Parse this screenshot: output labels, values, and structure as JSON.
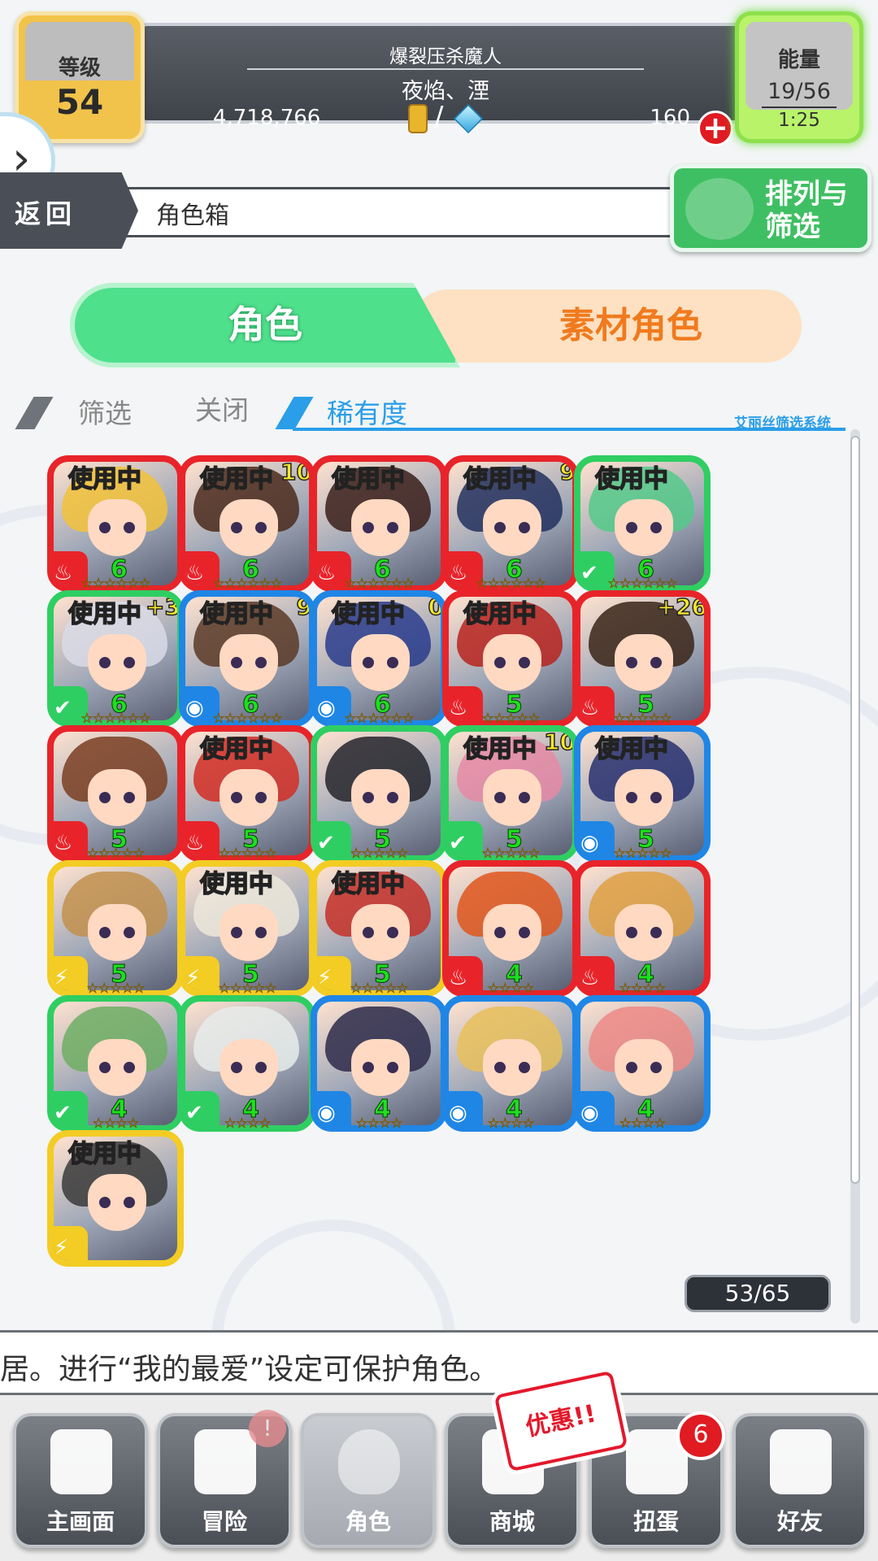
{
  "header": {
    "level_label": "等级",
    "level_value": "54",
    "title_line1": "爆裂压杀魔人",
    "title_line2": "夜焰、湮",
    "gold": "4,718,766",
    "currency_sep": "/",
    "gems": "160",
    "energy_label": "能量",
    "energy_value": "19/56",
    "energy_timer": "1:25"
  },
  "subbar": {
    "back_label": "返回",
    "title": "角色箱",
    "sort_label": "排列与筛选"
  },
  "tabs": {
    "characters": "角色",
    "materials": "素材角色"
  },
  "filter": {
    "filter_label": "筛选",
    "state_label": "关闭",
    "sort_key": "稀有度",
    "system_label": "艾丽丝筛选系统"
  },
  "cards": [
    {
      "elem": "fire",
      "rank": "6",
      "stars": "☆☆☆☆☆☆",
      "in_use": "使用中",
      "luck": "",
      "hair": "#f2c23a"
    },
    {
      "elem": "fire",
      "rank": "6",
      "stars": "☆☆☆☆☆☆",
      "in_use": "使用中",
      "luck": "10",
      "hair": "#4b2a1c"
    },
    {
      "elem": "fire",
      "rank": "6",
      "stars": "☆☆☆☆☆☆",
      "in_use": "使用中",
      "luck": "",
      "hair": "#3b1e1a"
    },
    {
      "elem": "fire",
      "rank": "6",
      "stars": "☆☆☆☆☆☆",
      "in_use": "使用中",
      "luck": "9",
      "hair": "#23305e"
    },
    {
      "elem": "wood",
      "rank": "6",
      "stars": "☆☆☆☆☆☆",
      "in_use": "使用中",
      "luck": "",
      "hair": "#55c98a"
    },
    {
      "elem": "wood",
      "rank": "6",
      "stars": "☆☆☆☆☆☆",
      "in_use": "使用中",
      "luck": "+3",
      "hair": "#d9dbe6"
    },
    {
      "elem": "water",
      "rank": "6",
      "stars": "☆☆☆☆☆☆",
      "in_use": "使用中",
      "luck": "9",
      "hair": "#5a3a26"
    },
    {
      "elem": "water",
      "rank": "6",
      "stars": "☆☆☆☆☆☆",
      "in_use": "使用中",
      "luck": "0",
      "hair": "#2a3c8c"
    },
    {
      "elem": "fire",
      "rank": "5",
      "stars": "☆☆☆☆☆",
      "in_use": "使用中",
      "luck": "",
      "hair": "#b8231e"
    },
    {
      "elem": "fire",
      "rank": "5",
      "stars": "☆☆☆☆☆",
      "in_use": "",
      "luck": "+26",
      "hair": "#3a2418"
    },
    {
      "elem": "fire",
      "rank": "5",
      "stars": "☆☆☆☆☆",
      "in_use": "",
      "luck": "",
      "hair": "#7a3e22"
    },
    {
      "elem": "fire",
      "rank": "5",
      "stars": "☆☆☆☆☆",
      "in_use": "使用中",
      "luck": "",
      "hair": "#d22e24"
    },
    {
      "elem": "wood",
      "rank": "5",
      "stars": "☆☆☆☆☆",
      "in_use": "",
      "luck": "",
      "hair": "#25252b"
    },
    {
      "elem": "wood",
      "rank": "5",
      "stars": "☆☆☆☆☆",
      "in_use": "使用中",
      "luck": "10",
      "hair": "#e68aa6"
    },
    {
      "elem": "water",
      "rank": "5",
      "stars": "☆☆☆☆☆",
      "in_use": "使用中",
      "luck": "",
      "hair": "#28306e"
    },
    {
      "elem": "light",
      "rank": "5",
      "stars": "☆☆☆☆☆",
      "in_use": "",
      "luck": "",
      "hair": "#c2904e"
    },
    {
      "elem": "light",
      "rank": "5",
      "stars": "☆☆☆☆☆",
      "in_use": "使用中",
      "luck": "",
      "hair": "#ece7da"
    },
    {
      "elem": "light",
      "rank": "5",
      "stars": "☆☆☆☆☆",
      "in_use": "使用中",
      "luck": "",
      "hair": "#c43028"
    },
    {
      "elem": "fire",
      "rank": "4",
      "stars": "☆☆☆☆",
      "in_use": "",
      "luck": "",
      "hair": "#e0561c"
    },
    {
      "elem": "fire",
      "rank": "4",
      "stars": "☆☆☆☆",
      "in_use": "",
      "luck": "",
      "hair": "#e0a042"
    },
    {
      "elem": "wood",
      "rank": "4",
      "stars": "☆☆☆☆",
      "in_use": "",
      "luck": "",
      "hair": "#6fae64"
    },
    {
      "elem": "wood",
      "rank": "4",
      "stars": "☆☆☆☆",
      "in_use": "",
      "luck": "",
      "hair": "#e8ecea"
    },
    {
      "elem": "water",
      "rank": "4",
      "stars": "☆☆☆☆",
      "in_use": "",
      "luck": "",
      "hair": "#2d2a4a"
    },
    {
      "elem": "water",
      "rank": "4",
      "stars": "☆☆☆☆",
      "in_use": "",
      "luck": "",
      "hair": "#e7bf5a"
    },
    {
      "elem": "water",
      "rank": "4",
      "stars": "☆☆☆☆",
      "in_use": "",
      "luck": "",
      "hair": "#ef8a86"
    },
    {
      "elem": "light",
      "rank": "",
      "stars": "",
      "in_use": "使用中",
      "luck": "",
      "hair": "#3a3a3a"
    }
  ],
  "element_colors": {
    "fire": "#e8242a",
    "wood": "#2fce62",
    "water": "#1f86e6",
    "light": "#f3cc24"
  },
  "element_icons": {
    "fire": "fire-icon",
    "wood": "wood-icon",
    "water": "water-icon",
    "light": "light-icon"
  },
  "box_count": "53/65",
  "tip": "居。进行“我的最爱”设定可保护角色。",
  "nav": [
    {
      "label": "主画面",
      "icon": "home-icon"
    },
    {
      "label": "冒险",
      "icon": "fist-bump-icon"
    },
    {
      "label": "角色",
      "icon": "rabbit-icon"
    },
    {
      "label": "商城",
      "icon": "cart-icon"
    },
    {
      "label": "扭蛋",
      "icon": "egg-icon"
    },
    {
      "label": "好友",
      "icon": "friends-icon"
    }
  ],
  "sale_label": "优惠!!",
  "gacha_badge": "6"
}
